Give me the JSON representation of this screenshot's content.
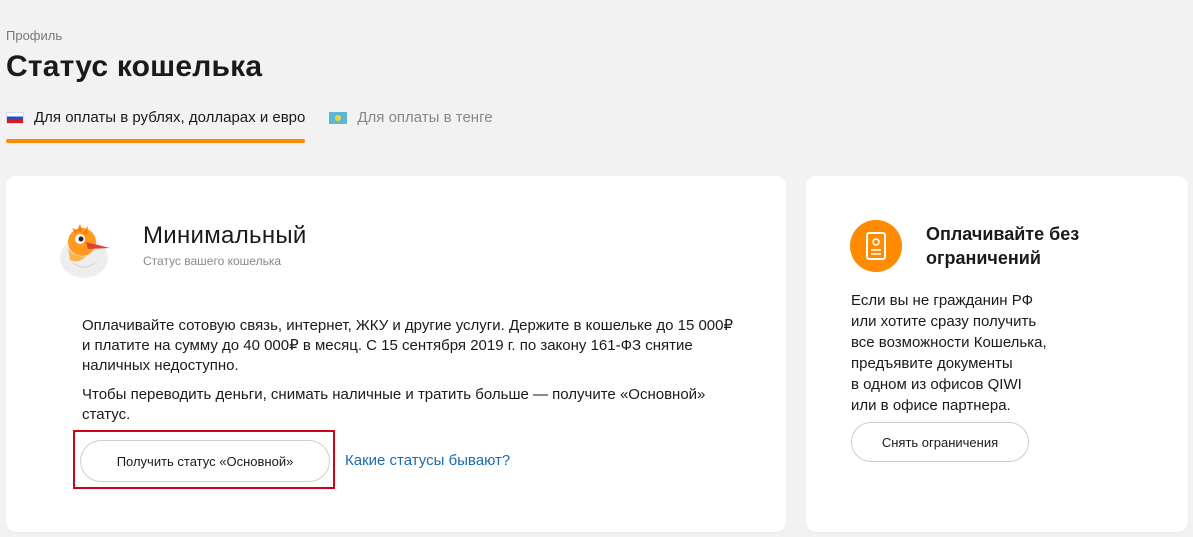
{
  "breadcrumb": "Профиль",
  "page_title": "Статус кошелька",
  "tabs": [
    {
      "label": "Для оплаты в рублях, долларах и евро",
      "icon": "russia-flag-icon",
      "active": true
    },
    {
      "label": "Для оплаты в тенге",
      "icon": "kazakhstan-flag-icon",
      "active": false
    }
  ],
  "status_card": {
    "avatar_icon": "qiwi-bird-mascot-icon",
    "title": "Минимальный",
    "subtitle": "Статус вашего кошелька",
    "paragraph_1": "Оплачивайте сотовую связь, интернет, ЖКУ и другие услуги. Держите в кошельке до 15 000₽ и платите на сумму до 40 000₽ в месяц. С 15 сентября 2019 г. по закону 161-ФЗ снятие наличных недоступно.",
    "paragraph_2": "Чтобы переводить деньги, снимать наличные и тратить больше — получите «Основной» статус.",
    "primary_button": "Получить статус «Основной»",
    "link": "Какие статусы бывают?"
  },
  "side_card": {
    "icon": "document-icon",
    "title": "Оплачивайте без ограничений",
    "text_lines": [
      "Если вы не гражданин РФ",
      "или хотите сразу получить",
      "все возможности Кошелька,",
      "предъявите документы",
      "в одном из офисов QIWI",
      "или в офисе партнера."
    ],
    "button": "Снять ограничения"
  },
  "colors": {
    "accent": "#ff8c00",
    "link": "#1a6bb5",
    "highlight": "#d0021b",
    "background": "#f2f2f2"
  }
}
